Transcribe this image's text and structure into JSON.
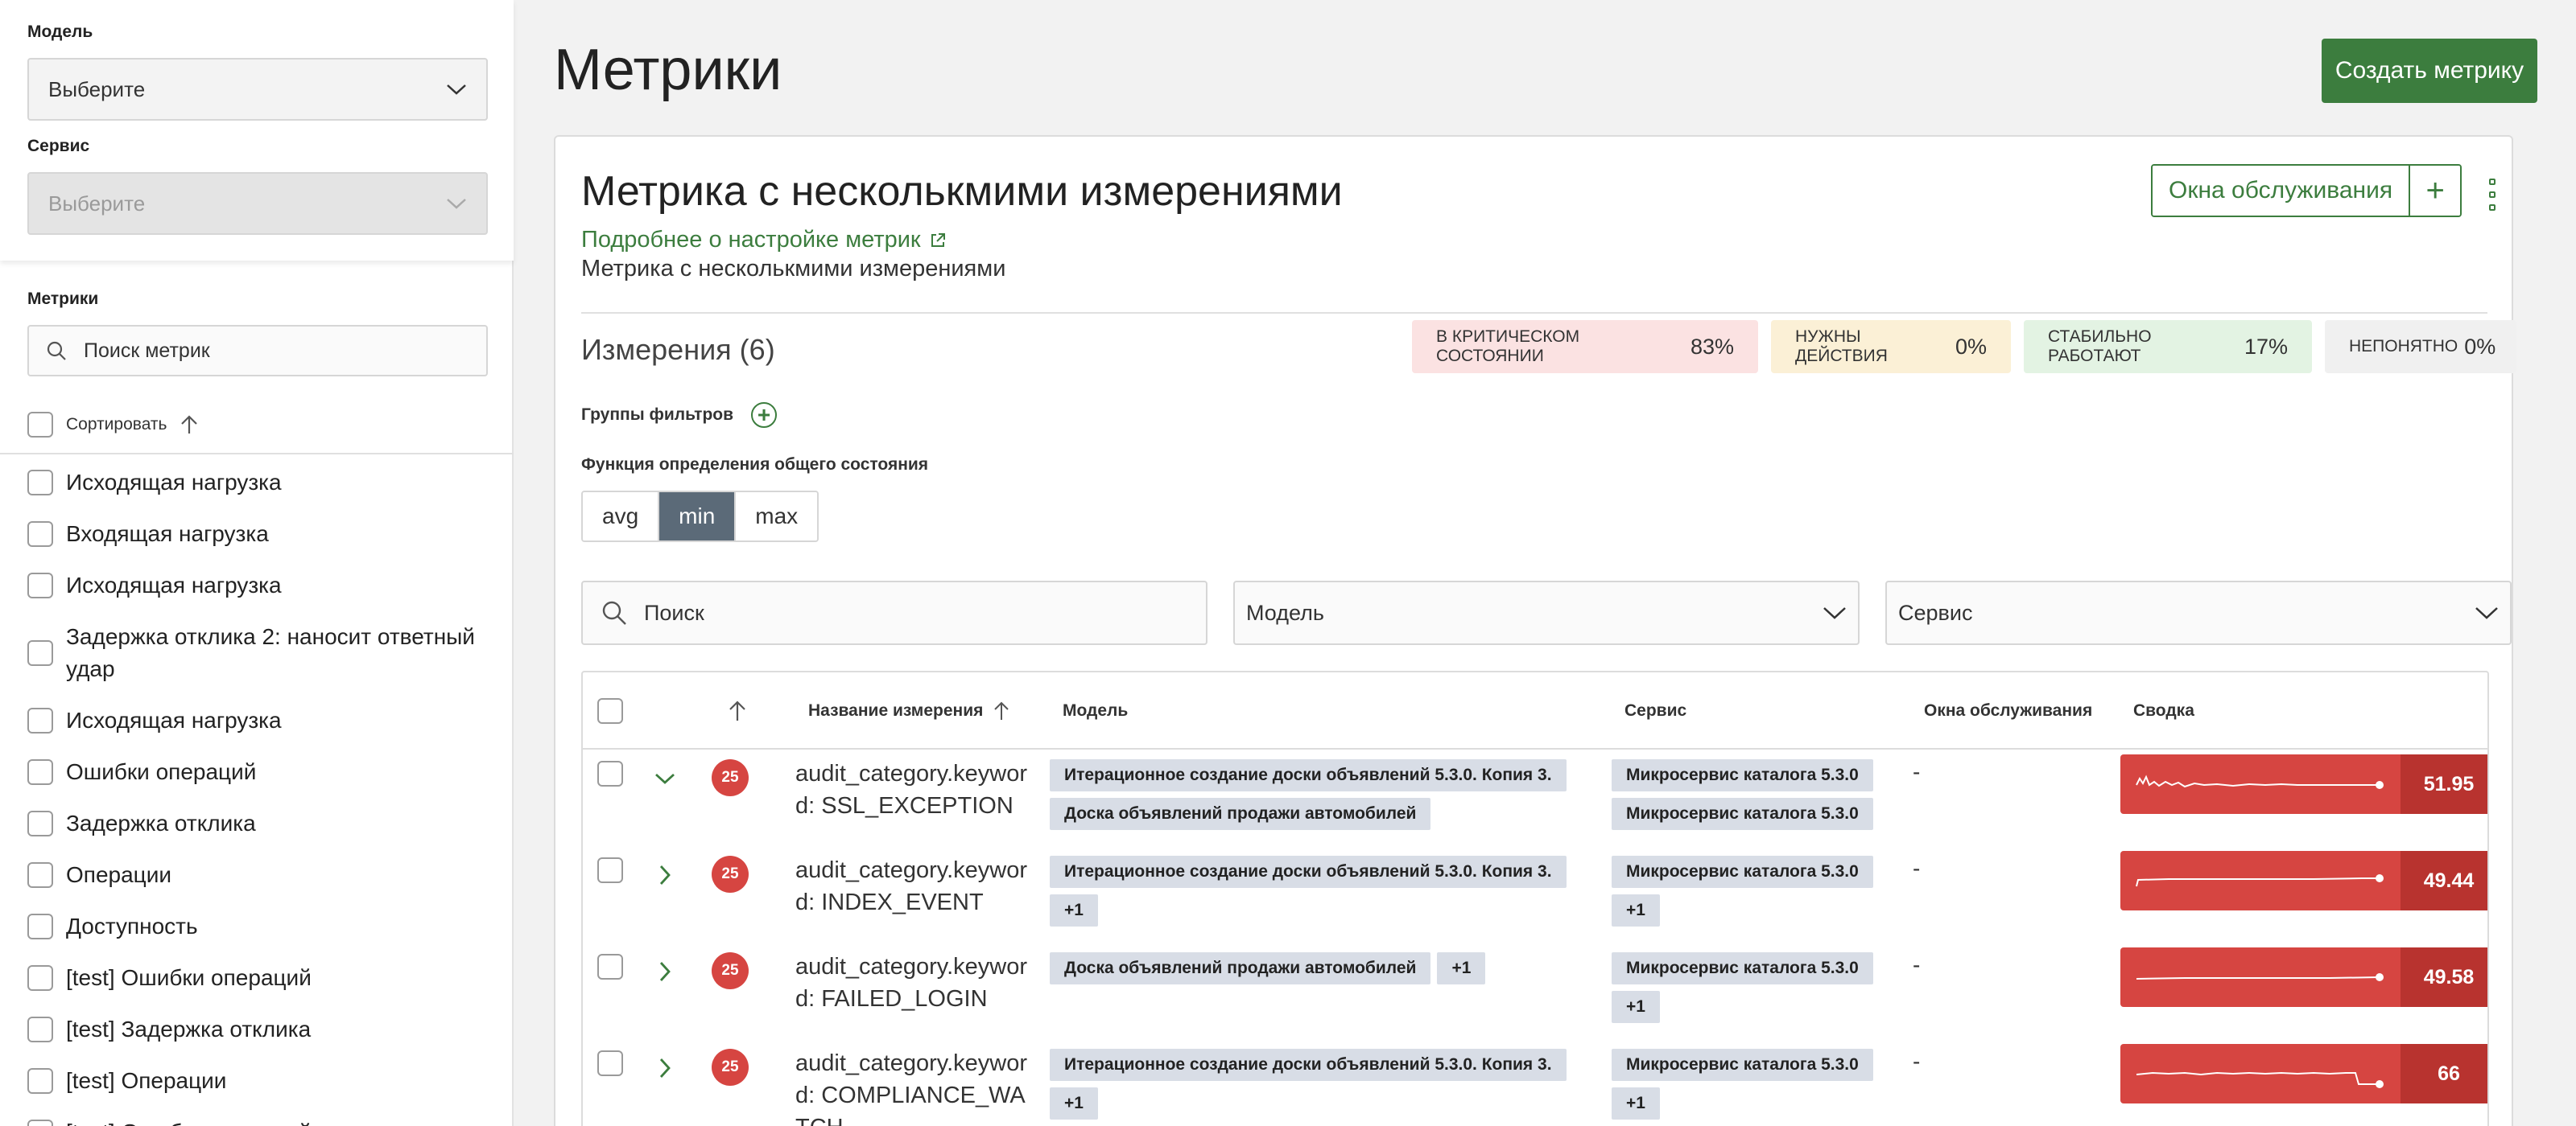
{
  "sidebar": {
    "model_label": "Модель",
    "model_placeholder": "Выберите",
    "service_label": "Сервис",
    "service_placeholder": "Выберите",
    "metrics_label": "Метрики",
    "search_placeholder": "Поиск метрик",
    "sort_label": "Сортировать",
    "items": [
      {
        "label": "Исходящая нагрузка"
      },
      {
        "label": "Входящая нагрузка"
      },
      {
        "label": "Исходящая нагрузка"
      },
      {
        "label": "Задержка отклика 2: наносит ответный удар"
      },
      {
        "label": "Исходящая нагрузка"
      },
      {
        "label": "Ошибки операций"
      },
      {
        "label": "Задержка отклика"
      },
      {
        "label": "Операции"
      },
      {
        "label": "Доступность"
      },
      {
        "label": "[test] Ошибки операций"
      },
      {
        "label": "[test] Задержка отклика"
      },
      {
        "label": "[test] Операции"
      },
      {
        "label": "[test] Ошибки операций"
      }
    ]
  },
  "header": {
    "title": "Метрики",
    "create_button": "Создать метрику"
  },
  "card": {
    "title": "Метрика с несколькмими измерениями",
    "link": "Подробнее о настройке метрик",
    "description": "Метрика с несколькмими измерениями",
    "maintenance_button": "Окна обслуживания",
    "maintenance_add": "+"
  },
  "dimensions": {
    "title": "Измерения (6)",
    "badges": {
      "critical": {
        "label": "В КРИТИЧЕСКОМ СОСТОЯНИИ",
        "pct": "83%"
      },
      "action": {
        "label": "НУЖНЫ ДЕЙСТВИЯ",
        "pct": "0%"
      },
      "stable": {
        "label": "СТАБИЛЬНО РАБОТАЮТ",
        "pct": "17%"
      },
      "unknown": {
        "label": "НЕПОНЯТНО",
        "pct": "0%"
      }
    },
    "filter_groups_label": "Группы фильтров",
    "function_label": "Функция определения общего состояния",
    "functions": [
      "avg",
      "min",
      "max"
    ],
    "active_function": "min",
    "search_placeholder": "Поиск",
    "model_filter": "Модель",
    "service_filter": "Сервис"
  },
  "table": {
    "headers": {
      "name": "Название измерения",
      "model": "Модель",
      "service": "Сервис",
      "maintenance": "Окна обслуживания",
      "summary": "Сводка"
    },
    "rows": [
      {
        "status": "25",
        "name": "audit_category.keyword: SSL_EXCEPTION",
        "models": [
          "Итерационное создание доски объявлений 5.3.0. Копия 3.",
          "Доска объявлений продажи автомобилей"
        ],
        "services": [
          "Микросервис каталога 5.3.0",
          "Микросервис каталога 5.3.0"
        ],
        "maintenance": "-",
        "value": "51.95",
        "expanded": true
      },
      {
        "status": "25",
        "name": "audit_category.keyword: INDEX_EVENT",
        "models": [
          "Итерационное создание доски объявлений 5.3.0. Копия 3.",
          "+1"
        ],
        "services": [
          "Микросервис каталога 5.3.0",
          "+1"
        ],
        "maintenance": "-",
        "value": "49.44",
        "expanded": false
      },
      {
        "status": "25",
        "name": "audit_category.keyword: FAILED_LOGIN",
        "models": [
          "Доска объявлений продажи автомобилей",
          "+1"
        ],
        "services": [
          "Микросервис каталога 5.3.0",
          "+1"
        ],
        "maintenance": "-",
        "value": "49.58",
        "expanded": false
      },
      {
        "status": "25",
        "name": "audit_category.keyword: COMPLIANCE_WATCH",
        "models": [
          "Итерационное создание доски объявлений 5.3.0. Копия 3.",
          "+1"
        ],
        "services": [
          "Микросервис каталога 5.3.0",
          "+1"
        ],
        "maintenance": "-",
        "value": "66",
        "expanded": false
      }
    ]
  },
  "colors": {
    "accent_green": "#3c7d3e",
    "critical_red": "#d64541",
    "segment_active": "#5b6a78"
  }
}
